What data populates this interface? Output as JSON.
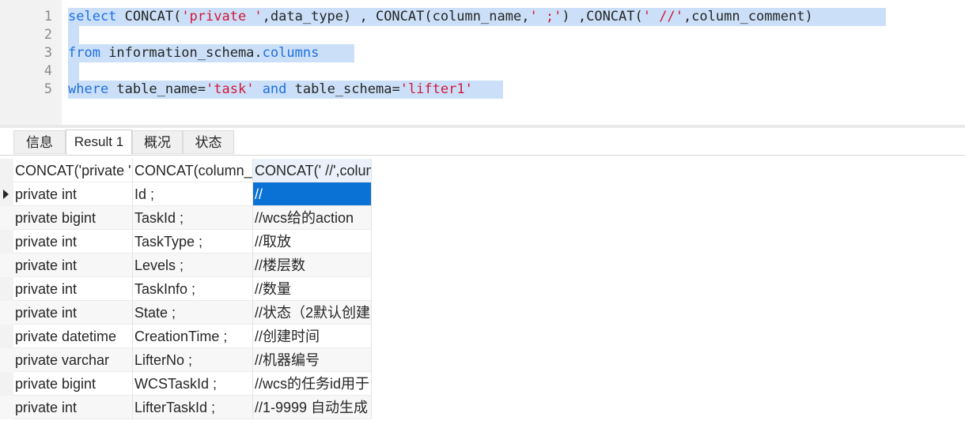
{
  "editor": {
    "lines": [
      {
        "num": "1",
        "tokens": [
          {
            "t": "select",
            "k": "kw"
          },
          {
            "t": " CONCAT(",
            "k": "txt"
          },
          {
            "t": "'private '",
            "k": "str"
          },
          {
            "t": ",data_type) , CONCAT(column_name,",
            "k": "txt"
          },
          {
            "t": "' ;'",
            "k": "str"
          },
          {
            "t": ") ,CONCAT(",
            "k": "txt"
          },
          {
            "t": "' //'",
            "k": "str"
          },
          {
            "t": ",column_comment)",
            "k": "txt"
          }
        ]
      },
      {
        "num": "2",
        "tokens": []
      },
      {
        "num": "3",
        "tokens": [
          {
            "t": "from",
            "k": "kw"
          },
          {
            "t": " information_schema.",
            "k": "txt"
          },
          {
            "t": "columns",
            "k": "kw"
          },
          {
            "t": "  ",
            "k": "txt"
          }
        ]
      },
      {
        "num": "4",
        "tokens": []
      },
      {
        "num": "5",
        "tokens": [
          {
            "t": "where",
            "k": "kw"
          },
          {
            "t": " table_name=",
            "k": "txt"
          },
          {
            "t": "'task'",
            "k": "str"
          },
          {
            "t": " ",
            "k": "txt"
          },
          {
            "t": "and",
            "k": "kw"
          },
          {
            "t": " table_schema=",
            "k": "txt"
          },
          {
            "t": "'lifter1'",
            "k": "str"
          }
        ]
      }
    ]
  },
  "tabs": {
    "info": "信息",
    "result1": "Result 1",
    "overview": "概况",
    "status": "状态"
  },
  "result": {
    "headers": [
      "CONCAT('private ',data_type)",
      "CONCAT(column_name,' ;')",
      "CONCAT(' //',column_comment)"
    ],
    "rows": [
      [
        "private int",
        "Id ;",
        "//"
      ],
      [
        "private bigint",
        "TaskId ;",
        "//wcs给的action"
      ],
      [
        "private int",
        "TaskType ;",
        "//取放"
      ],
      [
        "private int",
        "Levels ;",
        "//楼层数"
      ],
      [
        "private int",
        "TaskInfo ;",
        "//数量"
      ],
      [
        "private int",
        "State ;",
        "//状态（2默认创建"
      ],
      [
        "private datetime",
        "CreationTime ;",
        "//创建时间"
      ],
      [
        "private varchar",
        "LifterNo ;",
        "//机器编号"
      ],
      [
        "private bigint",
        "WCSTaskId ;",
        "//wcs的任务id用于"
      ],
      [
        "private int",
        "LifterTaskId ;",
        "//1-9999 自动生成"
      ]
    ]
  },
  "colors": {
    "keyword": "#1f6fe0",
    "string": "#d2173b",
    "selection": "#cbe0f8",
    "selected_cell": "#0a72d4"
  }
}
